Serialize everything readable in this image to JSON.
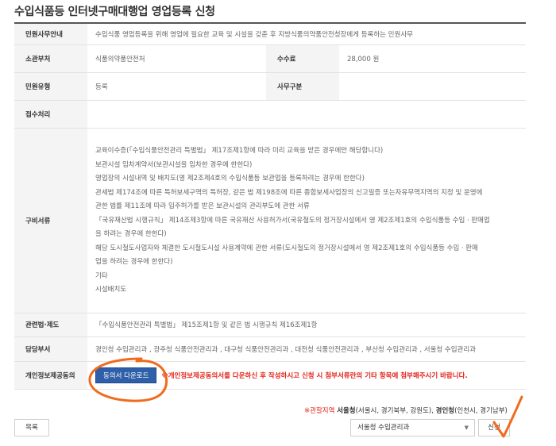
{
  "title": "수입식품등 인터넷구매대행업 영업등록 신청",
  "rows": {
    "civil_info": {
      "label": "민원사무안내",
      "value": "수입식품 영업등록을 위해 영업에 필요한 교육 및 시설을 갖춘 후 지방식품의약품안전청장에게 등록하는 민원사무"
    },
    "dept": {
      "label": "소관부처",
      "value": "식품의약품안전처"
    },
    "fee": {
      "label": "수수료",
      "value": "28,000 원"
    },
    "civil_type": {
      "label": "민원유형",
      "value": "등록"
    },
    "work_class": {
      "label": "사무구분",
      "value": ""
    },
    "receipt": {
      "label": "접수처리",
      "value": ""
    },
    "docs": {
      "label": "구비서류",
      "items": [
        "교육이수증(「수입식품안전관리 특별법」 제17조제1항에 따라 미리 교육을 받은 경우에만 해당합니다)",
        "보관시설 임차계약서(보관시설을 임차한 경우에 한한다)",
        "영업장의 시설내역 및 배치도(영 제2조제4호의 수입식품등 보관업을 등록하려는 경우에 한한다)",
        "관세법 제174조에 따른 특허보세구역의 특허장, 같은 법 제198조에 따른 종합보세사업장의 신고필증 또는자유무역지역의 지정 및 운영에",
        "관한 법률 제11조에 따라 입주허가를 받은 보관시설의 관리부도에 관한 서류",
        "「국유재산법 시행규칙」 제14조제3항에 따른 국유재산 사용허가서(국유철도의 정거장시설에서 영 제2조제1호의 수입식품등 수입ㆍ판매업",
        "을 하려는 경우에 한한다)",
        "해당 도시철도사업자와 체결한 도시철도시설 사용계약에 관한 서류(도시철도의 정거장시설에서 영 제2조제1호의 수입식품등 수입ㆍ판매",
        "업을 하려는 경우에 한한다)",
        "기타",
        "시설배치도"
      ]
    },
    "law": {
      "label": "관련법·제도",
      "value": "「수입식품안전관리 특별법」 제15조제1항 및 같은 법 시행규칙 제16조제1항"
    },
    "office": {
      "label": "담당부서",
      "value": "경인청 수입관리과 , 광주청 식품안전관리과 , 대구청 식품안전관리과 , 대전청 식품안전관리과 , 부산청 수입관리과 , 서울청 수입관리과"
    },
    "privacy": {
      "label": "개인정보제공동의",
      "button": "동의서 다운로드",
      "notice_asterisk": "※",
      "notice": "개인정보제공동의서를 다운하신 후 작성하시고 신청 시 첨부서류란의 기타 항목에 첨부해주시기 바랍니다."
    }
  },
  "bottom_note": {
    "prefix": "※관할지역",
    "seoul_label": "서울청",
    "seoul_region": "(서울시, 경기북부, 강원도),",
    "gyeongin_label": "경인청",
    "gyeongin_region": "(인천시, 경기남부)"
  },
  "actions": {
    "list_button": "목록",
    "office_select": "서울청 수입관리과",
    "apply_button": "신청"
  },
  "colors": {
    "download_button": "#2e5fa8",
    "notice_red": "#e2231a",
    "annotation_orange": "#f26a1b"
  }
}
